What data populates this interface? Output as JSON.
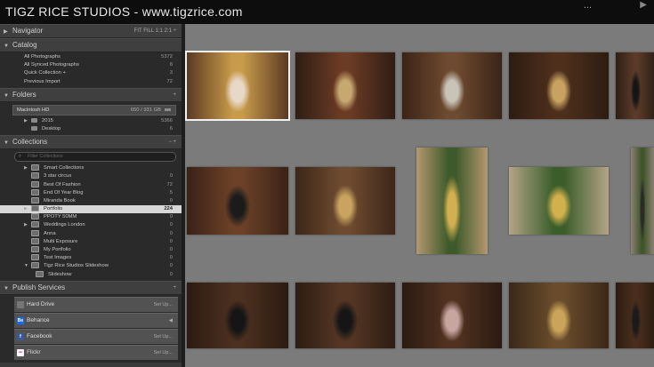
{
  "app": {
    "title": "TIGZ RICE STUDIOS - www.tigzrice.com",
    "menu_text": "...",
    "menu_arrow": "▶"
  },
  "navigator": {
    "title": "Navigator",
    "options": "FIT   FILL   1:1   2:1 ÷"
  },
  "catalog": {
    "title": "Catalog",
    "items": [
      {
        "label": "All Photographs",
        "count": "5372"
      },
      {
        "label": "All Synced Photographs",
        "count": "8"
      },
      {
        "label": "Quick Collection  +",
        "count": "3"
      },
      {
        "label": "Previous Import",
        "count": "72"
      }
    ]
  },
  "folders": {
    "title": "Folders",
    "drive": {
      "label": "Macintosh HD",
      "info": "650 / 931 GB"
    },
    "items": [
      {
        "label": "2015",
        "count": "5366"
      },
      {
        "label": "Desktop",
        "count": "6"
      }
    ]
  },
  "collections": {
    "title": "Collections",
    "filter_placeholder": "Filter Collections",
    "items": [
      {
        "label": "Smart Collections",
        "count": ""
      },
      {
        "label": "3 star circus",
        "count": "0"
      },
      {
        "label": "Best Of Fashion",
        "count": "72"
      },
      {
        "label": "End Of Year Blog",
        "count": "5"
      },
      {
        "label": "Miranda Book",
        "count": "0"
      },
      {
        "label": "Portfolio",
        "count": "224"
      },
      {
        "label": "PPOTY 50MM",
        "count": "0"
      },
      {
        "label": "Weddings London",
        "count": "0"
      },
      {
        "label": "Anna",
        "count": "0"
      },
      {
        "label": "Multi Exposure",
        "count": "0"
      },
      {
        "label": "My Portfolio",
        "count": "0"
      },
      {
        "label": "Test Images",
        "count": "0"
      },
      {
        "label": "Tigz Rice Studios Slideshow",
        "count": "0"
      },
      {
        "label": "Slideshow",
        "count": "0"
      }
    ]
  },
  "publish": {
    "title": "Publish Services",
    "items": [
      {
        "label": "Hard Drive",
        "setup": "Set Up...",
        "badge": "",
        "color": "#7a7a7a"
      },
      {
        "label": "Behance",
        "setup": "◀",
        "badge": "Be",
        "color": "#1769ff"
      },
      {
        "label": "Facebook",
        "setup": "Set Up...",
        "badge": "f",
        "color": "#3b5998"
      },
      {
        "label": "Flickr",
        "setup": "Set Up...",
        "badge": "••",
        "color": "#ffffff"
      }
    ]
  },
  "colors": {
    "grid_bg": "#7b7b7b",
    "panel_bg": "#2a2a2a",
    "header_bg": "#3f3f3f",
    "selection": "#d7d7d7"
  },
  "grid": {
    "photos": [
      {
        "name": "photo-1",
        "selected": true,
        "palette": [
          "#5a3a22",
          "#c89b4a",
          "#e8d8c8"
        ]
      },
      {
        "name": "photo-2",
        "selected": false,
        "palette": [
          "#2e1d14",
          "#6b3b24",
          "#c7a870"
        ]
      },
      {
        "name": "photo-3",
        "selected": false,
        "palette": [
          "#3b2417",
          "#6e4a30",
          "#c9c4b8"
        ]
      },
      {
        "name": "photo-4",
        "selected": false,
        "palette": [
          "#2d1c12",
          "#4e2f1c",
          "#c8a260"
        ]
      },
      {
        "name": "photo-5",
        "selected": false,
        "palette": [
          "#2e1e15",
          "#5a3a28",
          "#151515"
        ]
      },
      {
        "name": "photo-6",
        "selected": false,
        "palette": [
          "#3a2216",
          "#6c4128",
          "#1b1b1b"
        ]
      },
      {
        "name": "photo-7",
        "selected": false,
        "palette": [
          "#3b2618",
          "#6e4b30",
          "#c8a460"
        ]
      },
      {
        "name": "photo-8",
        "selected": false,
        "palette": [
          "#b29870",
          "#3e5a2a",
          "#d0b050"
        ]
      },
      {
        "name": "photo-9",
        "selected": false,
        "palette": [
          "#b3a486",
          "#3a5d2a",
          "#d2b04c"
        ]
      },
      {
        "name": "photo-10",
        "selected": false,
        "palette": [
          "#8b8172",
          "#40552a",
          "#2a2a2a"
        ]
      },
      {
        "name": "photo-11",
        "selected": false,
        "palette": [
          "#2b1b12",
          "#4c3020",
          "#151515"
        ]
      },
      {
        "name": "photo-12",
        "selected": false,
        "palette": [
          "#2d1d13",
          "#553624",
          "#151515"
        ]
      },
      {
        "name": "photo-13",
        "selected": false,
        "palette": [
          "#2a1a12",
          "#513220",
          "#c8a6a0"
        ]
      },
      {
        "name": "photo-14",
        "selected": false,
        "palette": [
          "#3a2818",
          "#6a4c2c",
          "#c9a45a"
        ]
      },
      {
        "name": "photo-15",
        "selected": false,
        "palette": [
          "#2b1b12",
          "#4a2e1d",
          "#1a1a1a"
        ]
      }
    ]
  }
}
